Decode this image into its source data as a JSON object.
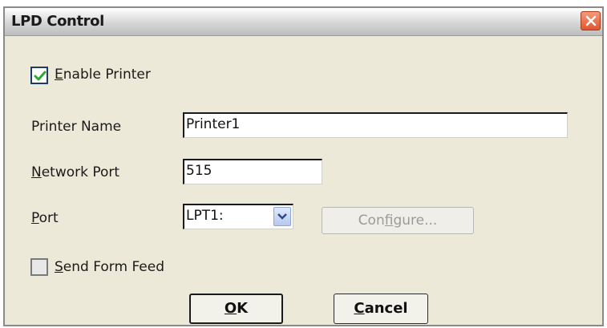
{
  "window": {
    "title": "LPD Control",
    "close_icon": "close-icon"
  },
  "enable_printer": {
    "checked": true,
    "label_prefix": "",
    "label_mnemonic": "E",
    "label_rest": "nable Printer"
  },
  "printer_name": {
    "label": "Printer Name",
    "value": "Printer1"
  },
  "network_port": {
    "label_mnemonic": "N",
    "label_rest": "etwork Port",
    "value": "515"
  },
  "port": {
    "label_mnemonic": "P",
    "label_rest": "ort",
    "selected": "LPT1:"
  },
  "configure_button": {
    "label_prefix": "Con",
    "label_mnemonic": "f",
    "label_rest": "igure...",
    "enabled": false
  },
  "send_form_feed": {
    "checked": false,
    "label_mnemonic": "S",
    "label_rest": "end Form Feed"
  },
  "buttons": {
    "ok_mnemonic": "O",
    "ok_rest": "K",
    "cancel_mnemonic": "C",
    "cancel_rest": "ancel"
  },
  "colors": {
    "close_button": "#e0562e",
    "checkmark": "#2fa82f",
    "dialog_bg": "#ece9d8"
  }
}
